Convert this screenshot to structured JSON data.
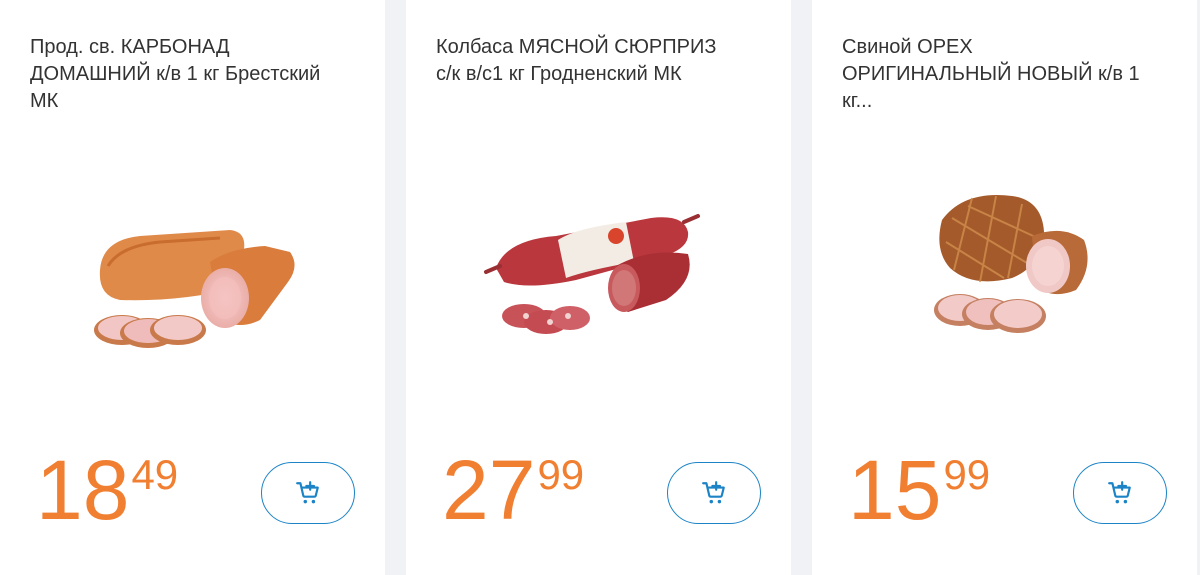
{
  "products": [
    {
      "title": "Прод. св. КАРБОНАД ДОМАШНИЙ к/в 1 кг Брестский МК",
      "price_int": "18",
      "price_frac": "49",
      "cart_icon": "add-to-cart-icon"
    },
    {
      "title": "Колбаса МЯСНОЙ СЮРПРИЗ с/к в/с1 кг Гродненский МК",
      "price_int": "27",
      "price_frac": "99",
      "cart_icon": "add-to-cart-icon"
    },
    {
      "title": "Свиной ОРЕХ ОРИГИНАЛЬНЫЙ НОВЫЙ к/в 1 кг...",
      "price_int": "15",
      "price_frac": "99",
      "cart_icon": "add-to-cart-icon"
    }
  ],
  "colors": {
    "price": "#f07f32",
    "accent": "#1c84c6",
    "background": "#f0f2f5",
    "card": "#ffffff",
    "text": "#333333"
  }
}
